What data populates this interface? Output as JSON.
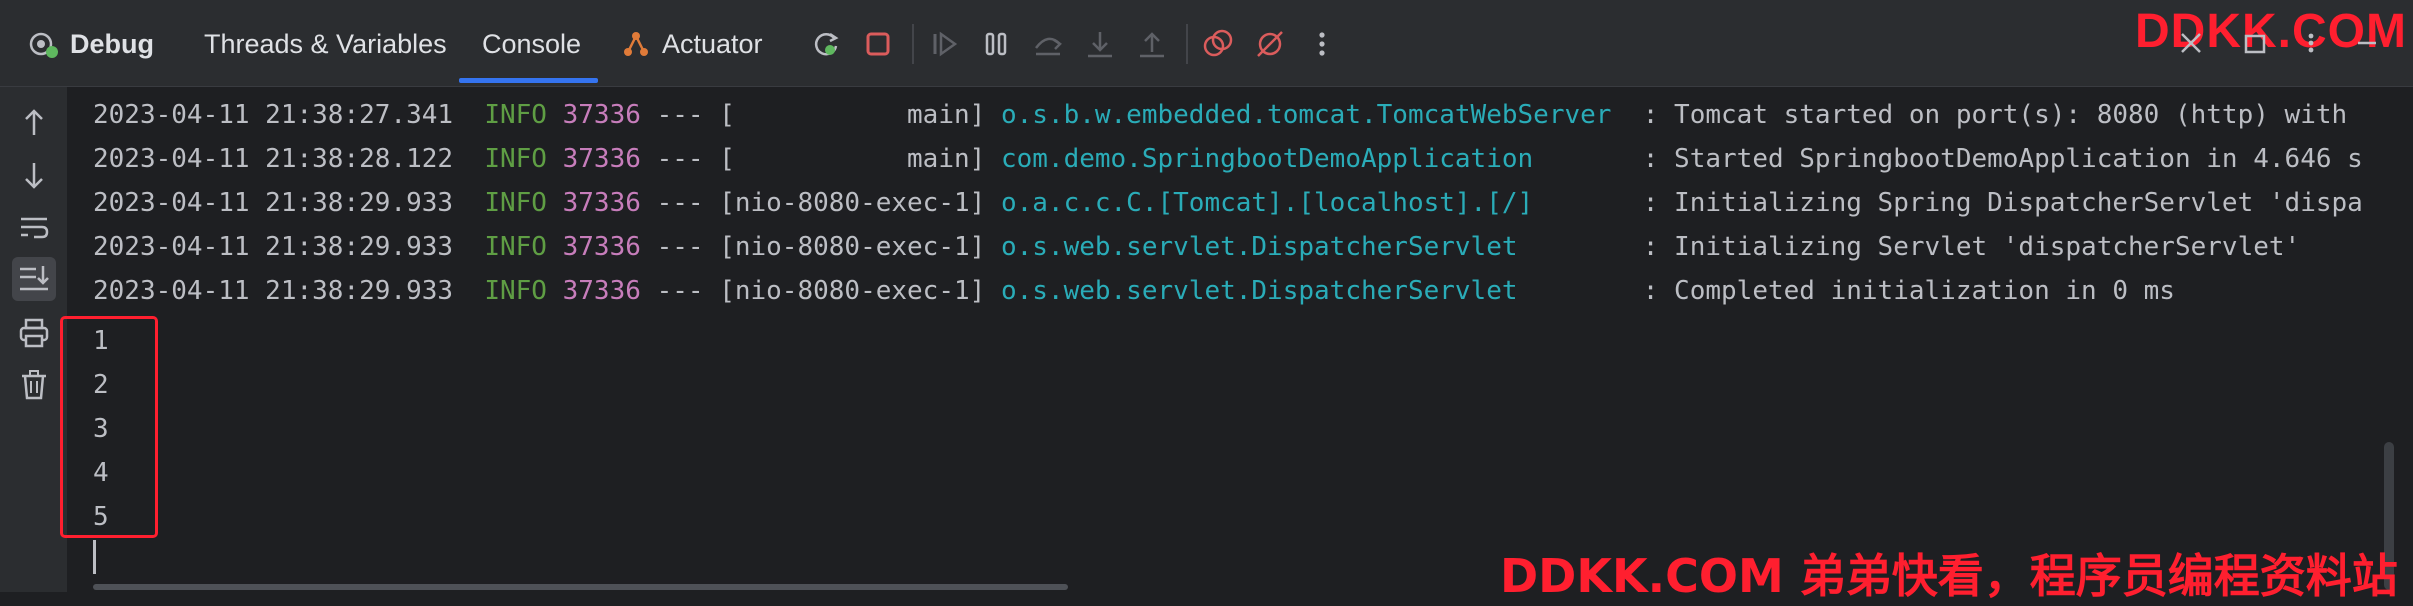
{
  "toolbar": {
    "title": "Debug",
    "tabs": [
      {
        "label": "Threads & Variables"
      },
      {
        "label": "Console"
      },
      {
        "label": "Actuator"
      }
    ],
    "active_tab": "Console",
    "accent_color": "#3574f0",
    "icons": [
      "rerun-icon",
      "stop-icon",
      "resume-icon",
      "pause-icon",
      "step-over-icon",
      "step-into-icon",
      "step-out-icon",
      "view-breakpoints-icon",
      "mute-breakpoints-icon",
      "more-icon"
    ]
  },
  "gutter": {
    "icons": [
      "up-arrow-icon",
      "down-arrow-icon",
      "soft-wrap-icon",
      "scroll-to-end-icon",
      "print-icon",
      "clear-icon"
    ]
  },
  "console": {
    "log_lines": [
      {
        "ts": "2023-04-11 21:38:27.341",
        "level": "INFO",
        "pid": "37336",
        "sep": "---",
        "thread": "[           main]",
        "logger": "o.s.b.w.embedded.tomcat.TomcatWebServer ",
        "msg": ": Tomcat started on port(s): 8080 (http) with"
      },
      {
        "ts": "2023-04-11 21:38:28.122",
        "level": "INFO",
        "pid": "37336",
        "sep": "---",
        "thread": "[           main]",
        "logger": "com.demo.SpringbootDemoApplication      ",
        "msg": ": Started SpringbootDemoApplication in 4.646 s"
      },
      {
        "ts": "2023-04-11 21:38:29.933",
        "level": "INFO",
        "pid": "37336",
        "sep": "---",
        "thread": "[nio-8080-exec-1]",
        "logger": "o.a.c.c.C.[Tomcat].[localhost].[/]      ",
        "msg": ": Initializing Spring DispatcherServlet 'dispa"
      },
      {
        "ts": "2023-04-11 21:38:29.933",
        "level": "INFO",
        "pid": "37336",
        "sep": "---",
        "thread": "[nio-8080-exec-1]",
        "logger": "o.s.web.servlet.DispatcherServlet       ",
        "msg": ": Initializing Servlet 'dispatcherServlet'"
      },
      {
        "ts": "2023-04-11 21:38:29.933",
        "level": "INFO",
        "pid": "37336",
        "sep": "---",
        "thread": "[nio-8080-exec-1]",
        "logger": "o.s.web.servlet.DispatcherServlet       ",
        "msg": ": Completed initialization in 0 ms"
      }
    ],
    "output_lines": [
      "1",
      "2",
      "3",
      "4",
      "5"
    ],
    "colors": {
      "level": "#5f9e44",
      "pid": "#c77dbb",
      "logger": "#2aacb8",
      "text": "#bcbec4",
      "highlight": "#ff1f2f"
    }
  },
  "watermark": {
    "top": "DDKK.COM",
    "bottom": "DDKK.COM 弟弟快看，程序员编程资料站"
  }
}
